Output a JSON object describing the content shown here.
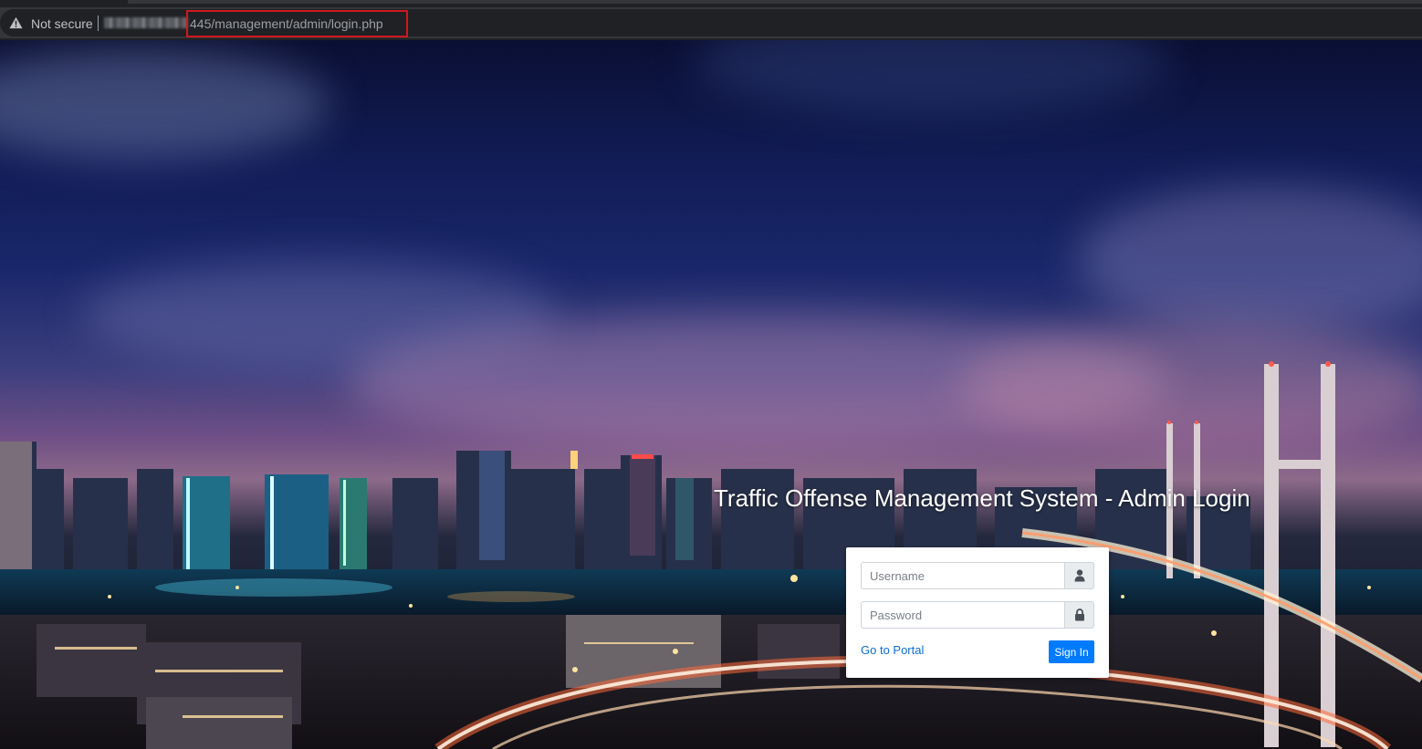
{
  "browser": {
    "security_label": "Not secure",
    "url_path": "445/management/admin/login.php"
  },
  "page": {
    "title": "Traffic Offense Management System - Admin Login"
  },
  "login_form": {
    "username_placeholder": "Username",
    "password_placeholder": "Password",
    "portal_link_label": "Go to Portal",
    "signin_label": "Sign In",
    "username_icon": "user-icon",
    "password_icon": "lock-icon"
  },
  "colors": {
    "primary_button": "#007bff",
    "link": "#0d6ecf",
    "url_highlight_border": "#d0181f"
  }
}
